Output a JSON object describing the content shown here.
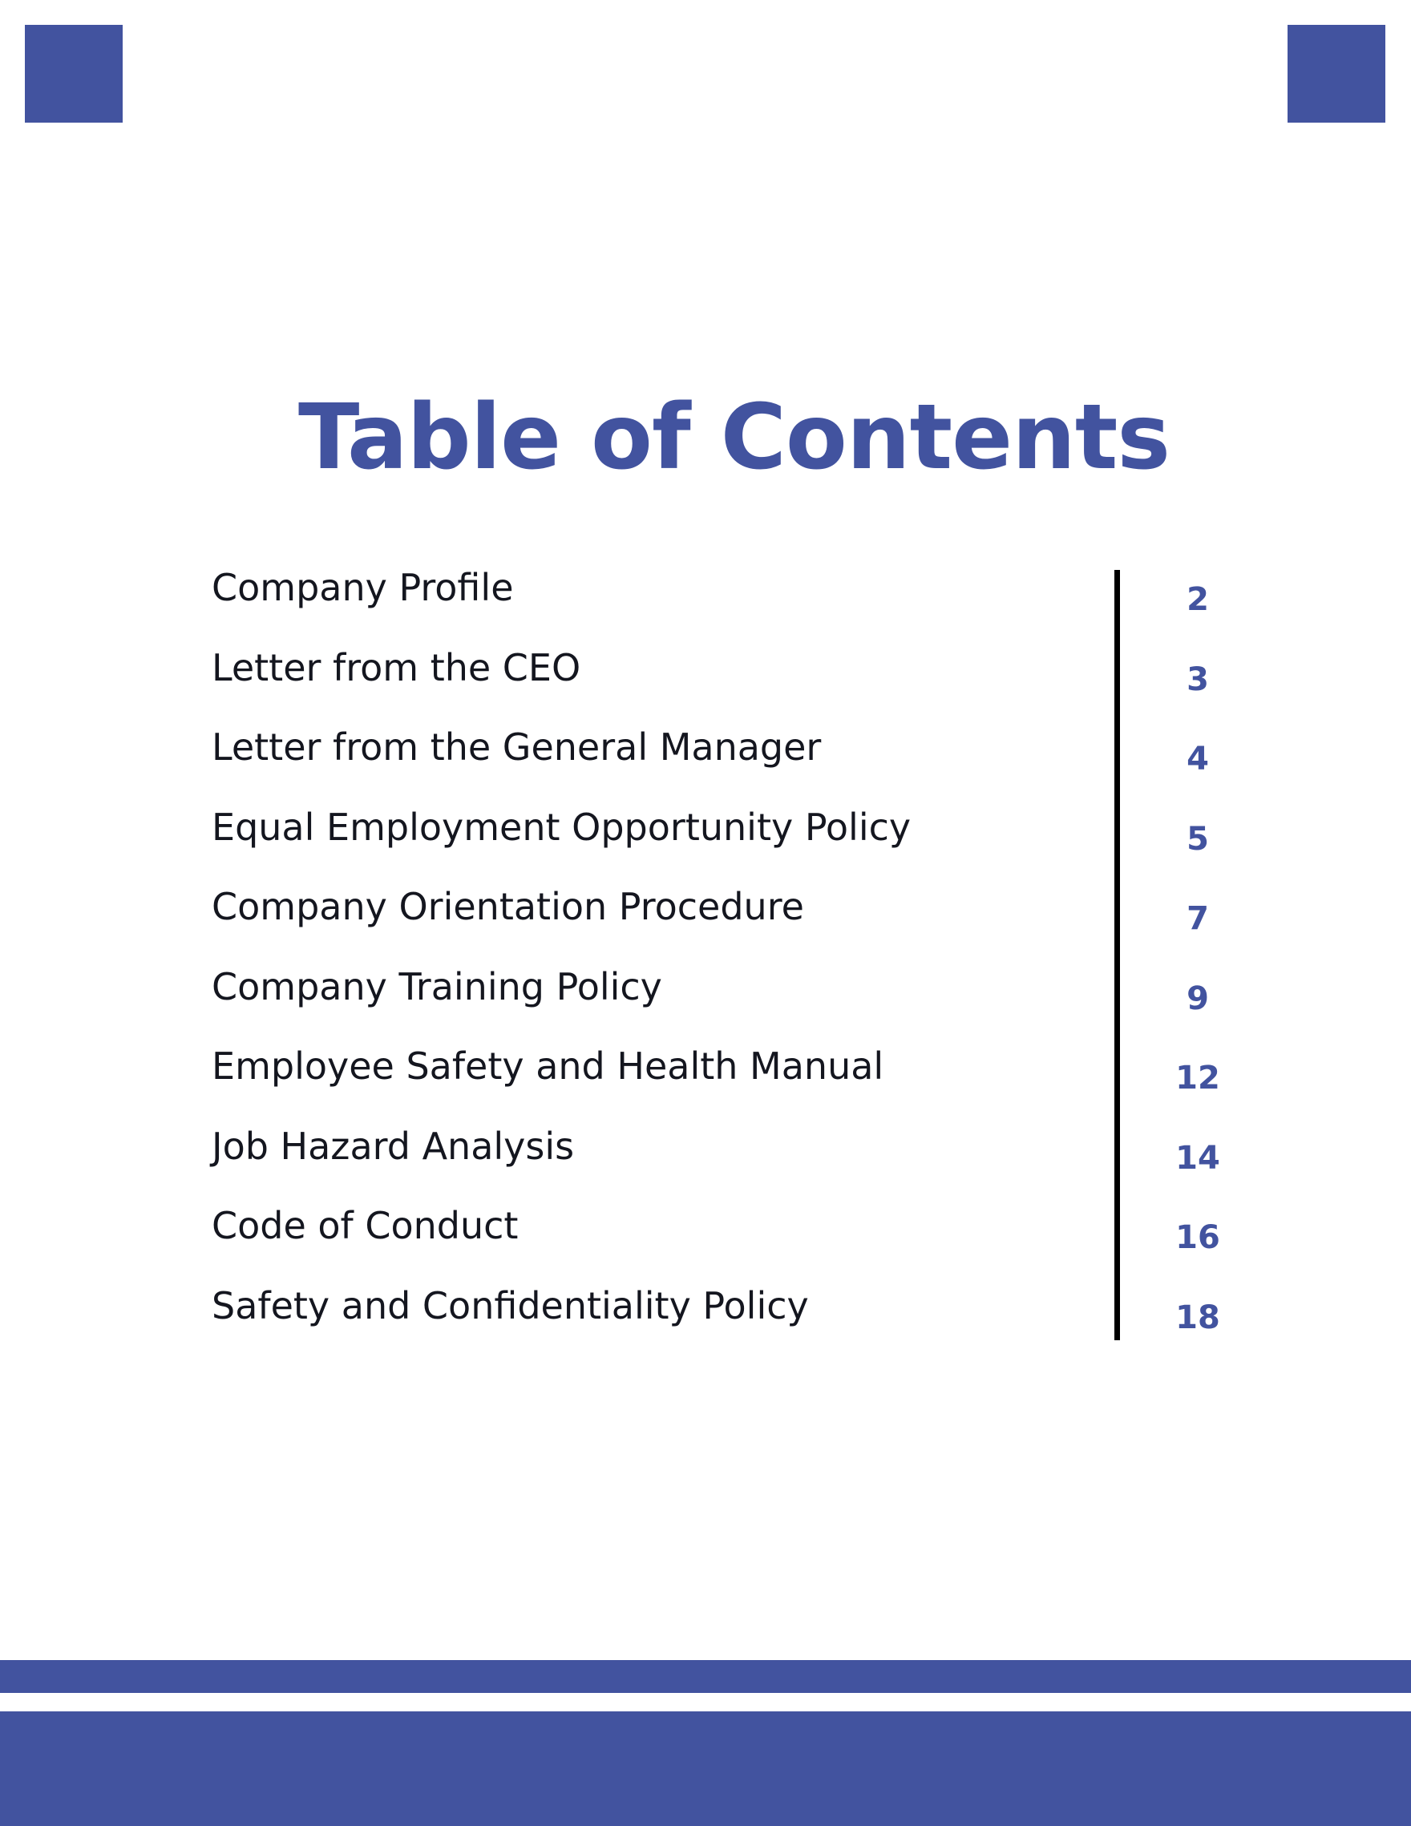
{
  "document": {
    "title": "Table of Contents",
    "theme": {
      "accent_blue": "#42539f",
      "entry_text": "#14161f",
      "divider": "#000000",
      "background": "#ffffff"
    }
  },
  "toc": {
    "entries": [
      {
        "label": "Company Profile",
        "page": "2"
      },
      {
        "label": "Letter from the CEO",
        "page": "3"
      },
      {
        "label": "Letter from the General Manager",
        "page": "4"
      },
      {
        "label": "Equal Employment Opportunity Policy",
        "page": "5"
      },
      {
        "label": "Company Orientation Procedure",
        "page": "7"
      },
      {
        "label": "Company Training Policy",
        "page": "9"
      },
      {
        "label": "Employee Safety and Health Manual",
        "page": "12"
      },
      {
        "label": "Job Hazard Analysis",
        "page": "14"
      },
      {
        "label": "Code of Conduct",
        "page": "16"
      },
      {
        "label": "Safety and Confidentiality Policy",
        "page": "18"
      }
    ]
  }
}
